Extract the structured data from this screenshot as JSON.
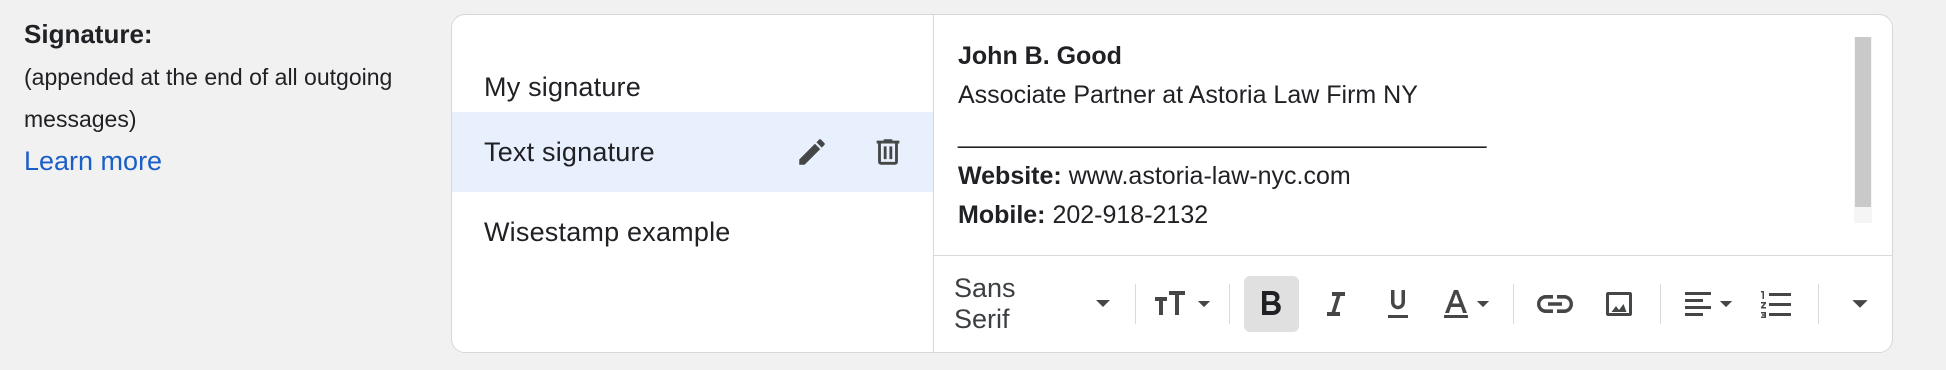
{
  "settings": {
    "label": "Signature:",
    "description": "(appended at the end of all outgoing messages)",
    "learn_more": "Learn more"
  },
  "signatures": {
    "items": [
      {
        "label": "My signature"
      },
      {
        "label": "Text signature"
      },
      {
        "label": "Wisestamp example"
      }
    ],
    "selected": "Text signature"
  },
  "editor": {
    "name": "John B. Good",
    "position": "Associate Partner at Astoria Law Firm NY",
    "separator": "______________________________________",
    "website_label": "Website:",
    "website_value": "www.astoria-law-nyc.com",
    "mobile_label": "Mobile:",
    "mobile_value": "202-918-2132"
  },
  "toolbar": {
    "font": "Sans Serif"
  },
  "icons": [
    "pencil-icon",
    "trash-icon",
    "text-size-icon",
    "bold-icon",
    "italic-icon",
    "underline-icon",
    "text-color-icon",
    "link-icon",
    "image-icon",
    "align-icon",
    "numbered-list-icon",
    "more-formatting-icon",
    "caret-down-icon"
  ],
  "colors": {
    "accent_link": "#1a5fc8",
    "selected_row": "#e8f0fe",
    "icon": "#444746"
  }
}
